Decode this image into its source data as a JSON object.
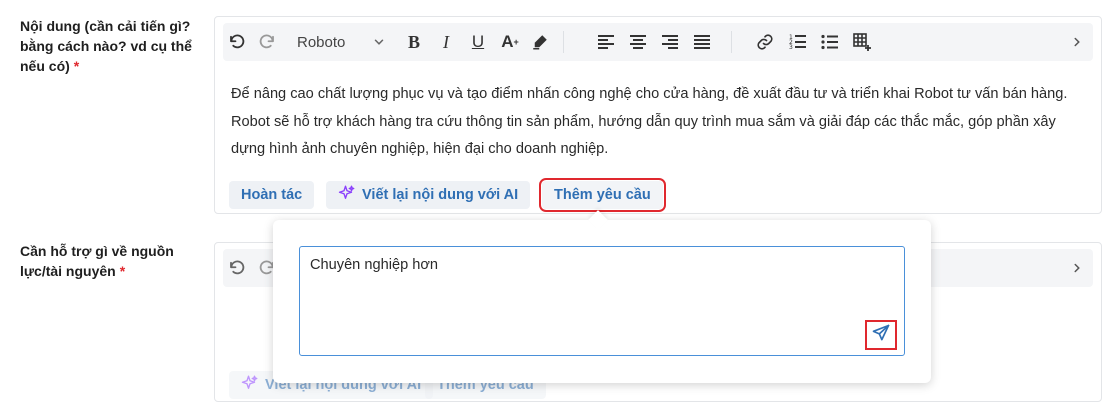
{
  "fields": [
    {
      "label": "Nội dung (cần cải tiến gì? bằng cách nào? vd cụ thể nếu có)",
      "required_mark": "*",
      "toolbar": {
        "font": "Roboto"
      },
      "content": "Để nâng cao chất lượng phục vụ và tạo điểm nhấn công nghệ cho cửa hàng, đề xuất đầu tư và triển khai Robot tư vấn bán hàng. Robot sẽ hỗ trợ khách hàng tra cứu thông tin sản phẩm, hướng dẫn quy trình mua sắm và giải đáp các thắc mắc, góp phần xây dựng hình ảnh chuyên nghiệp, hiện đại cho doanh nghiệp.",
      "actions": {
        "undo": "Hoàn tác",
        "rewrite_ai": "Viết lại nội dung với AI",
        "add_request": "Thêm yêu cầu"
      }
    },
    {
      "label": "Cần hỗ trợ gì về nguồn lực/tài nguyên",
      "required_mark": "*",
      "actions": {
        "rewrite_ai": "Viết lại nội dung với AI",
        "add_request": "Thêm yêu cầu"
      }
    }
  ],
  "popup": {
    "prompt_value": "Chuyên nghiệp hơn"
  },
  "colors": {
    "accent": "#2f6fb4",
    "highlight": "#e0282e",
    "ai_purple": "#8a3ffc"
  },
  "icons": [
    "undo-icon",
    "redo-icon",
    "chevron-down-icon",
    "bold-icon",
    "italic-icon",
    "underline-icon",
    "text-size-icon",
    "highlighter-icon",
    "align-left-icon",
    "align-center-icon",
    "align-right-icon",
    "align-justify-icon",
    "link-icon",
    "ordered-list-icon",
    "bullet-list-icon",
    "table-icon",
    "chevron-right-icon",
    "sparkle-icon",
    "send-icon"
  ]
}
